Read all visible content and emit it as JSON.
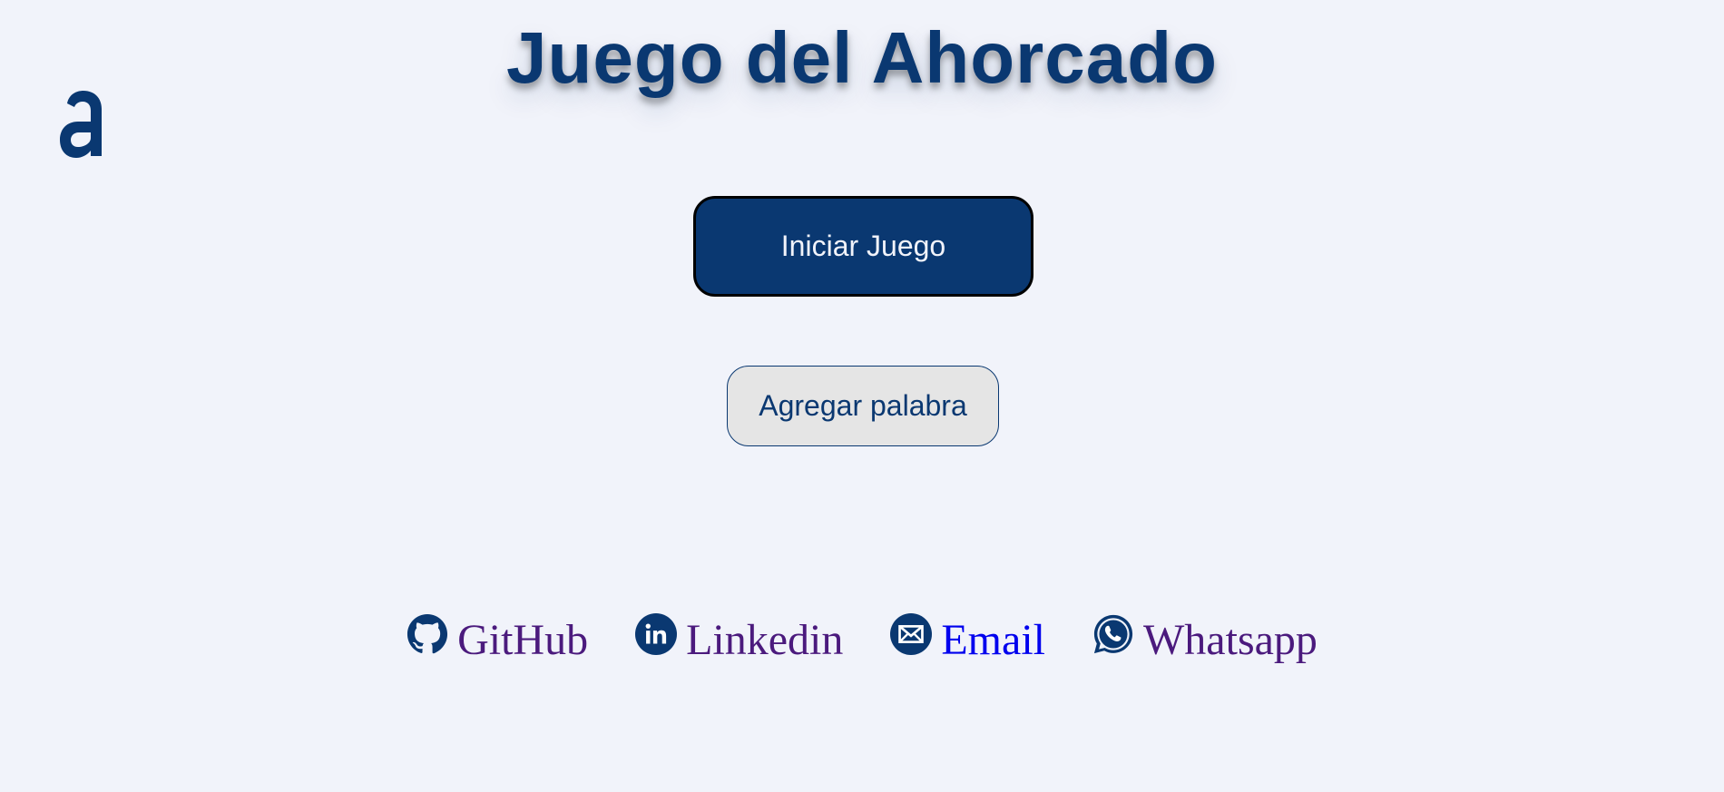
{
  "header": {
    "title": "Juego del Ahorcado"
  },
  "logo": {
    "icon": "alura-a-logo-icon",
    "glyph": "a"
  },
  "buttons": {
    "start_label": "Iniciar Juego",
    "add_word_label": "Agregar palabra"
  },
  "footer": {
    "links": [
      {
        "label": "GitHub",
        "icon": "github-icon"
      },
      {
        "label": "Linkedin",
        "icon": "linkedin-icon"
      },
      {
        "label": "Email",
        "icon": "email-icon"
      },
      {
        "label": "Whatsapp",
        "icon": "whatsapp-icon"
      }
    ]
  },
  "colors": {
    "brand": "#0a3871",
    "background": "#f1f3fa",
    "visited_link": "#4b1a7d",
    "link": "#0000ee",
    "secondary_button_bg": "#e5e5e5"
  }
}
